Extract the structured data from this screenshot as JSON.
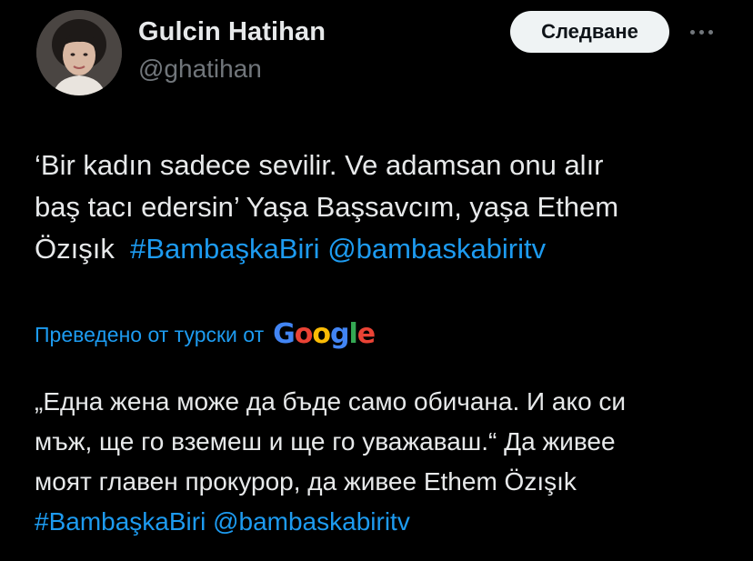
{
  "author": {
    "name": "Gulcin Hatihan",
    "handle": "@ghatihan",
    "avatar_icon": "profile-photo"
  },
  "actions": {
    "follow_label": "Следване",
    "more_icon": "more-horizontal-icon"
  },
  "tweet": {
    "lines": [
      {
        "text": "‘Bir kadın sadece sevilir. Ve adamsan onu alır"
      },
      {
        "text": "baş tacı edersin’ Yaşa Başsavcım, yaşa Ethem"
      },
      {
        "text": "Özışık  ",
        "hashtag": "#BambaşkaBiri",
        "mention": "@bambaskabiritv"
      }
    ]
  },
  "translation": {
    "label": "Преведено от турски от",
    "provider": [
      "G",
      "o",
      "o",
      "g",
      "l",
      "e"
    ],
    "lines": [
      {
        "text": "„Една жена може да бъде само обичана. И ако си"
      },
      {
        "text": "мъж, ще го вземеш и ще го уважаваш.“ Да живее"
      },
      {
        "text": "моят главен прокурор, да живее Ethem Özışık"
      }
    ],
    "hashtag": "#BambaşkaBiri",
    "mention": "@bambaskabiritv"
  },
  "colors": {
    "background": "#000000",
    "text": "#e7e9ea",
    "secondary": "#71767b",
    "link": "#1d9bf0",
    "button_bg": "#eff3f4"
  }
}
